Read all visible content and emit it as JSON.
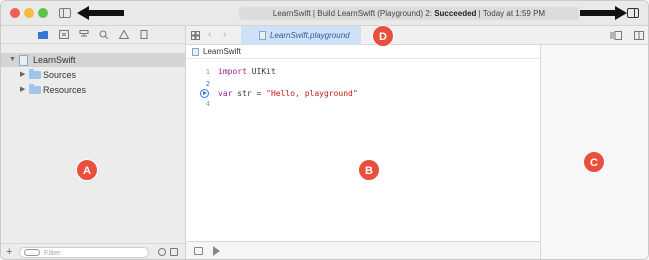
{
  "titlebar": {
    "activity_prefix": "LearnSwift | Build LearnSwift (Playground) 2: ",
    "activity_status": "Succeeded",
    "activity_suffix": " | Today at 1:59 PM"
  },
  "navigator": {
    "tree": [
      {
        "label": "LearnSwift",
        "icon": "playground-doc-icon",
        "expanded": true,
        "selected": true
      },
      {
        "label": "Sources",
        "icon": "folder-icon",
        "expanded": false
      },
      {
        "label": "Resources",
        "icon": "folder-icon",
        "expanded": false
      }
    ],
    "filter_placeholder": "Filter"
  },
  "editor": {
    "tab_label": "LearnSwift.playground",
    "jump_bar": "LearnSwift",
    "lines": [
      {
        "num": "1",
        "keyword": "import",
        "rest": " UIKit"
      },
      {
        "num": "2",
        "keyword": "",
        "rest": ""
      },
      {
        "num": "3",
        "keyword": "var",
        "rest": " str = ",
        "string": "\"Hello, playground\""
      },
      {
        "num": "4",
        "keyword": "",
        "rest": ""
      }
    ]
  },
  "callouts": {
    "a": "A",
    "b": "B",
    "c": "C",
    "d": "D"
  },
  "colors": {
    "callout": "#e8503e",
    "selected_tab": "#cfe1f6",
    "accent": "#3478d6"
  }
}
